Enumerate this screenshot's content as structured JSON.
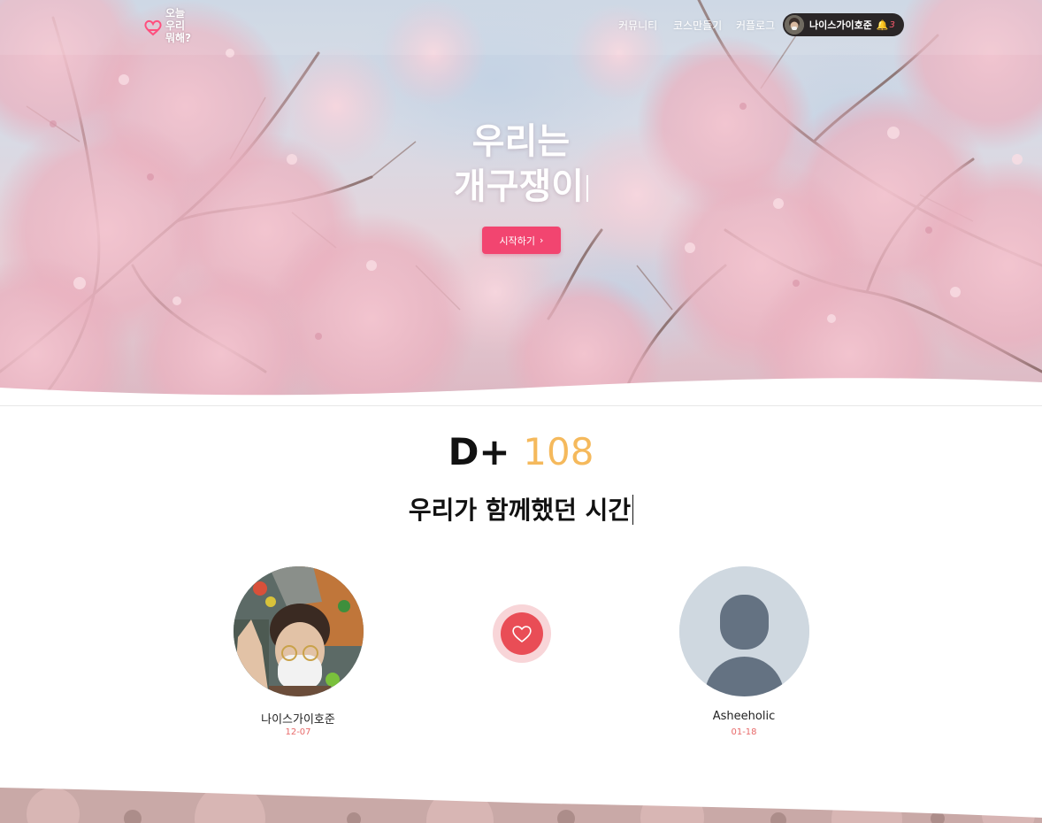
{
  "app": {
    "logo_text": "오늘\n우리\n뭐해?"
  },
  "nav": {
    "links": [
      "커뮤니티",
      "코스만들기",
      "커플로그"
    ],
    "user": {
      "name": "나이스가이호준",
      "notification_count": "3"
    }
  },
  "hero": {
    "title_line1": "우리는",
    "title_line2": "개구쟁이",
    "start_label": "시작하기"
  },
  "counter": {
    "prefix": "D+",
    "days": "108",
    "subtitle": "우리가 함께했던 시간"
  },
  "couple": {
    "left": {
      "name": "나이스가이호준",
      "date": "12-07"
    },
    "right": {
      "name": "Asheeholic",
      "date": "01-18"
    }
  },
  "colors": {
    "accent": "#f24570",
    "days": "#f5b95c",
    "heart": "#e94d56",
    "date": "#e86a6a"
  },
  "icons": {
    "heart": "heart-outline-icon",
    "bell": "bell-icon",
    "chevron": "chevron-right-icon",
    "avatar_placeholder": "person-silhouette-icon"
  }
}
